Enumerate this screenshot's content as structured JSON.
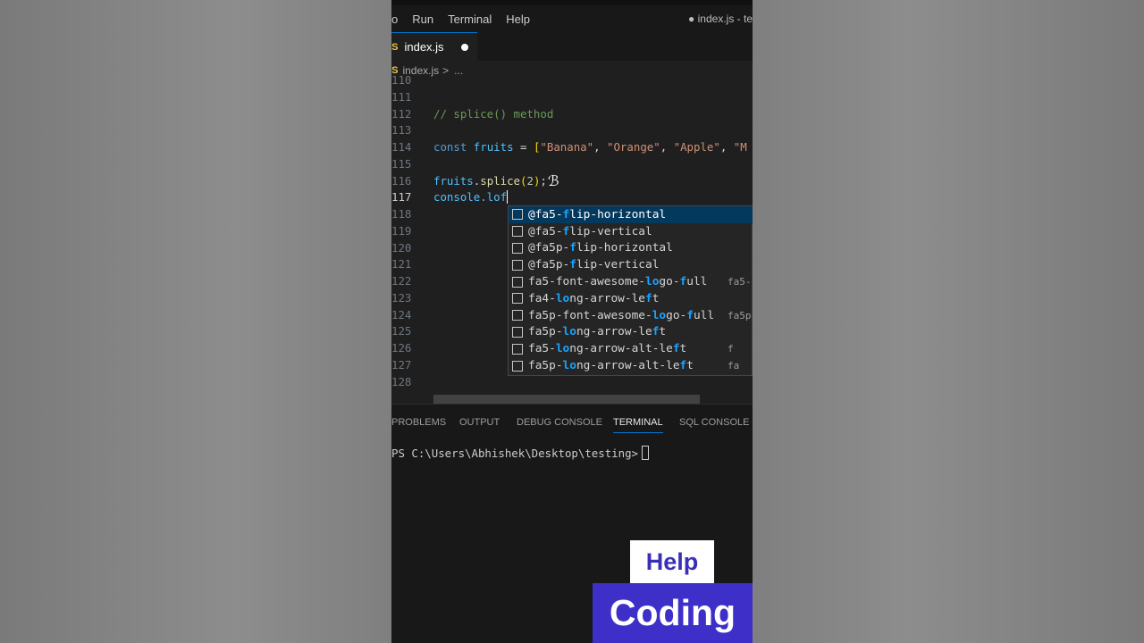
{
  "menubar": {
    "items": [
      "o",
      "Run",
      "Terminal",
      "Help"
    ],
    "window_title": "● index.js - te"
  },
  "tab": {
    "icon": "JS",
    "label": "index.js"
  },
  "breadcrumb": {
    "icon": "JS",
    "file": "index.js",
    "separator": ">",
    "rest": "..."
  },
  "editor": {
    "line_numbers": [
      "110",
      "111",
      "112",
      "113",
      "114",
      "115",
      "116",
      "117",
      "118",
      "119",
      "120",
      "121",
      "122",
      "123",
      "124",
      "125",
      "126",
      "127",
      "128"
    ],
    "active_line": "117",
    "comment": "// splice() method",
    "line114": {
      "keyword": "const",
      "name": "fruits",
      "op": " = ",
      "open": "[",
      "s1": "\"Banana\"",
      "s2": "\"Orange\"",
      "s3": "\"Apple\"",
      "s4": "\"M",
      "sep": ", "
    },
    "line116": {
      "obj": "fruits",
      "dot": ".",
      "method": "splice",
      "open": "(",
      "arg": "2",
      "close": ")",
      "end": ";"
    },
    "line117": {
      "text": "console.lof"
    }
  },
  "suggestions": [
    {
      "parts": [
        "@fa5-",
        "f",
        "lip-horizontal"
      ],
      "detail": ""
    },
    {
      "parts": [
        "@fa5-",
        "f",
        "lip-vertical"
      ],
      "detail": ""
    },
    {
      "parts": [
        "@fa5p-",
        "f",
        "lip-horizontal"
      ],
      "detail": ""
    },
    {
      "parts": [
        "@fa5p-",
        "f",
        "lip-vertical"
      ],
      "detail": ""
    },
    {
      "parts": [
        "fa5-font-awesome-",
        "lo",
        "go-",
        "f",
        "ull"
      ],
      "detail": "fa5-"
    },
    {
      "parts": [
        "fa4-",
        "lo",
        "ng-arrow-le",
        "f",
        "t"
      ],
      "detail": ""
    },
    {
      "parts": [
        "fa5p-font-awesome-",
        "lo",
        "go-",
        "f",
        "ull"
      ],
      "detail": "fa5p"
    },
    {
      "parts": [
        "fa5p-",
        "lo",
        "ng-arrow-le",
        "f",
        "t"
      ],
      "detail": ""
    },
    {
      "parts": [
        "fa5-",
        "lo",
        "ng-arrow-alt-le",
        "f",
        "t"
      ],
      "detail": "f"
    },
    {
      "parts": [
        "fa5p-",
        "lo",
        "ng-arrow-alt-le",
        "f",
        "t"
      ],
      "detail": "fa"
    }
  ],
  "panel": {
    "tabs": [
      "PROBLEMS",
      "OUTPUT",
      "DEBUG CONSOLE",
      "TERMINAL",
      "SQL CONSOLE"
    ],
    "active_tab": "TERMINAL",
    "prompt": "PS C:\\Users\\Abhishek\\Desktop\\testing>"
  },
  "overlay": {
    "help": "Help",
    "coding": "Coding"
  },
  "colors": {
    "accent": "#0078d4",
    "brand_purple": "#3d2fc8",
    "match_highlight": "#18a3ff"
  }
}
